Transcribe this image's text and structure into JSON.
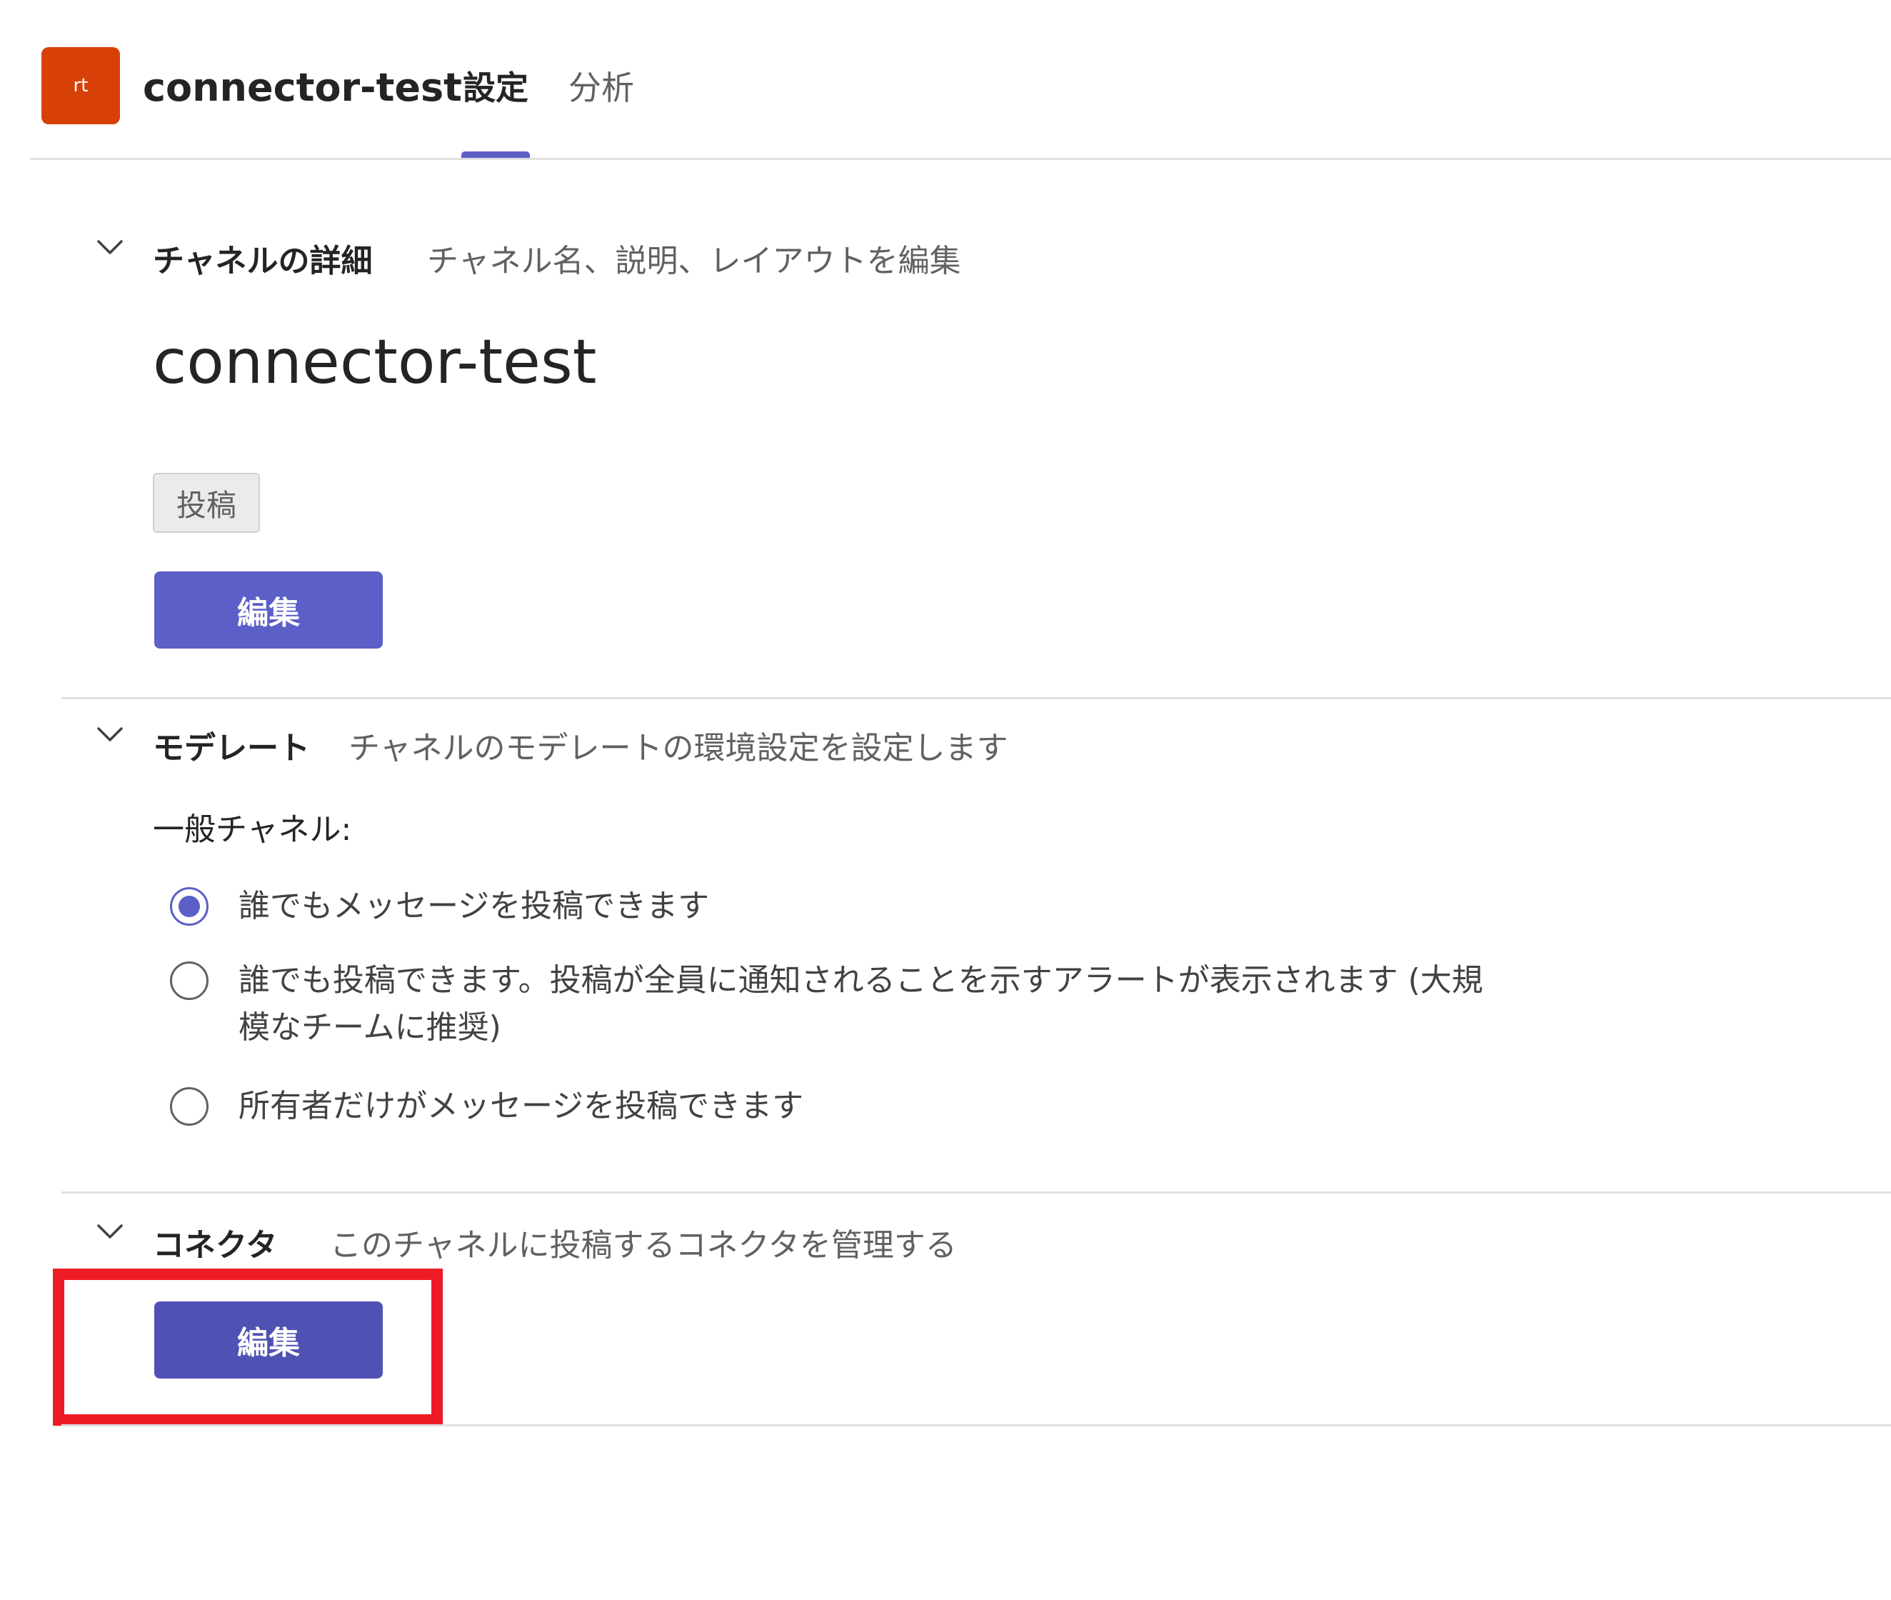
{
  "header": {
    "avatar_initials": "rt",
    "team_name": "connector-test",
    "tabs": [
      {
        "label": "設定",
        "active": true
      },
      {
        "label": "分析",
        "active": false
      }
    ]
  },
  "channel_details": {
    "title": "チャネルの詳細",
    "description": "チャネル名、説明、レイアウトを編集",
    "channel_name": "connector-test",
    "tag": "投稿",
    "edit_label": "編集"
  },
  "moderation": {
    "title": "モデレート",
    "description": "チャネルのモデレートの環境設定を設定します",
    "group_label": "一般チャネル:",
    "options": [
      {
        "label": "誰でもメッセージを投稿できます",
        "selected": true
      },
      {
        "label": "誰でも投稿できます。投稿が全員に通知されることを示すアラートが表示されます (大規模なチームに推奨)",
        "selected": false
      },
      {
        "label": "所有者だけがメッセージを投稿できます",
        "selected": false
      }
    ]
  },
  "connectors": {
    "title": "コネクタ",
    "description": "このチャネルに投稿するコネクタを管理する",
    "edit_label": "編集"
  },
  "colors": {
    "accent": "#5b5fc7",
    "accent_dark": "#4f52b2",
    "avatar_bg": "#d74108",
    "highlight": "#ed1c24"
  },
  "icons": {
    "section_toggle": "chevron-down-icon"
  }
}
